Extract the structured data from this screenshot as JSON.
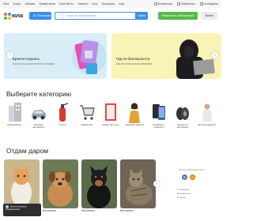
{
  "topnav": {
    "items": [
      "Юла",
      "Услуги",
      "Объявы",
      "Привлечение",
      "Юла Жесть",
      "Новости",
      "Блог",
      "Контракты",
      "Ещё"
    ],
    "right": [
      "Интересное",
      "Избранное",
      "Сообщения"
    ]
  },
  "header": {
    "logo": "юла",
    "categories_btn": "Категории",
    "search_placeholder": "Поиск по объявлениям",
    "search_btn": "Найти",
    "post_btn": "Разместить объявление",
    "login_btn": "Войти"
  },
  "banners": [
    {
      "title": "Бранчи покупать",
      "subtitle": "Еще больше качественных товаров"
    },
    {
      "title": "Гид по безопасности",
      "subtitle": "Как не попасться мошенникам"
    }
  ],
  "categories_title": "Выберите категорию",
  "categories": [
    {
      "label": "Недвижимость",
      "icon": "building-icon"
    },
    {
      "label": "Легковые автомобили",
      "icon": "car-icon"
    },
    {
      "label": "Услуги",
      "icon": "fire-extinguisher-icon"
    },
    {
      "label": "Знакомства",
      "icon": "cart-icon"
    },
    {
      "label": "Заявки на услуги",
      "icon": "frame-icon"
    },
    {
      "label": "Женский гардероб",
      "icon": "woman-icon"
    },
    {
      "label": "Телефоны и планшеты",
      "icon": "phone-icon"
    },
    {
      "label": "Запчасти и автотовары",
      "icon": "tires-icon"
    },
    {
      "label": "Детский гардероб",
      "icon": "kids-icon"
    }
  ],
  "giveaway_title": "Отдам даром",
  "giveaway_cards": [
    {
      "caption": "Бесплатно"
    },
    {
      "caption": "Бесплатно"
    },
    {
      "caption": "Бесплатно"
    },
    {
      "caption": "Бесплатно"
    }
  ],
  "side": {
    "title": "Юла в социальных сетях",
    "links": [
      "О компании",
      "Безопасность",
      "Помощь"
    ]
  },
  "toast": {
    "line1": "Хотите получать уведомления?",
    "line2": ""
  },
  "colors": {
    "accent": "#3c8ee8",
    "green": "#59b94a"
  }
}
